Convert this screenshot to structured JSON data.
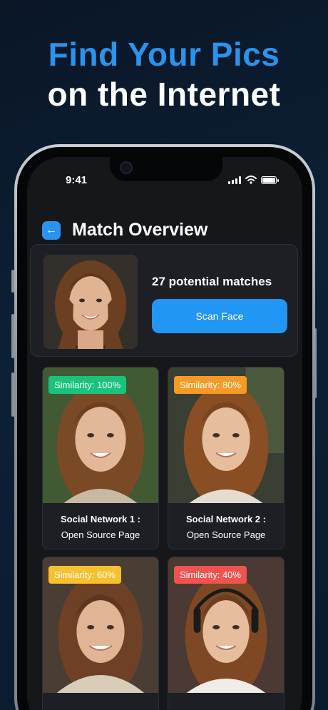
{
  "headline": {
    "line1": "Find Your Pics",
    "line2": "on the Internet"
  },
  "status_bar": {
    "time": "9:41"
  },
  "header": {
    "title": "Match Overview"
  },
  "overview": {
    "match_count": "27 potential matches",
    "scan_button": "Scan Face"
  },
  "results": [
    {
      "badge": "Similarity: 100%",
      "badge_color": "#19c37d",
      "line1": "Social Network 1 :",
      "line2": "Open Source Page"
    },
    {
      "badge": "Similarity: 80%",
      "badge_color": "#f59a23",
      "line1": "Social Network 2 :",
      "line2": "Open Source Page"
    },
    {
      "badge": "Similarity: 60%",
      "badge_color": "#f6c12e",
      "line1": "",
      "line2": ""
    },
    {
      "badge": "Similarity: 40%",
      "badge_color": "#ef5350",
      "line1": "",
      "line2": ""
    }
  ],
  "colors": {
    "accent": "#2a93ec",
    "background": "#0b1a2d",
    "screen": "#16171b"
  }
}
